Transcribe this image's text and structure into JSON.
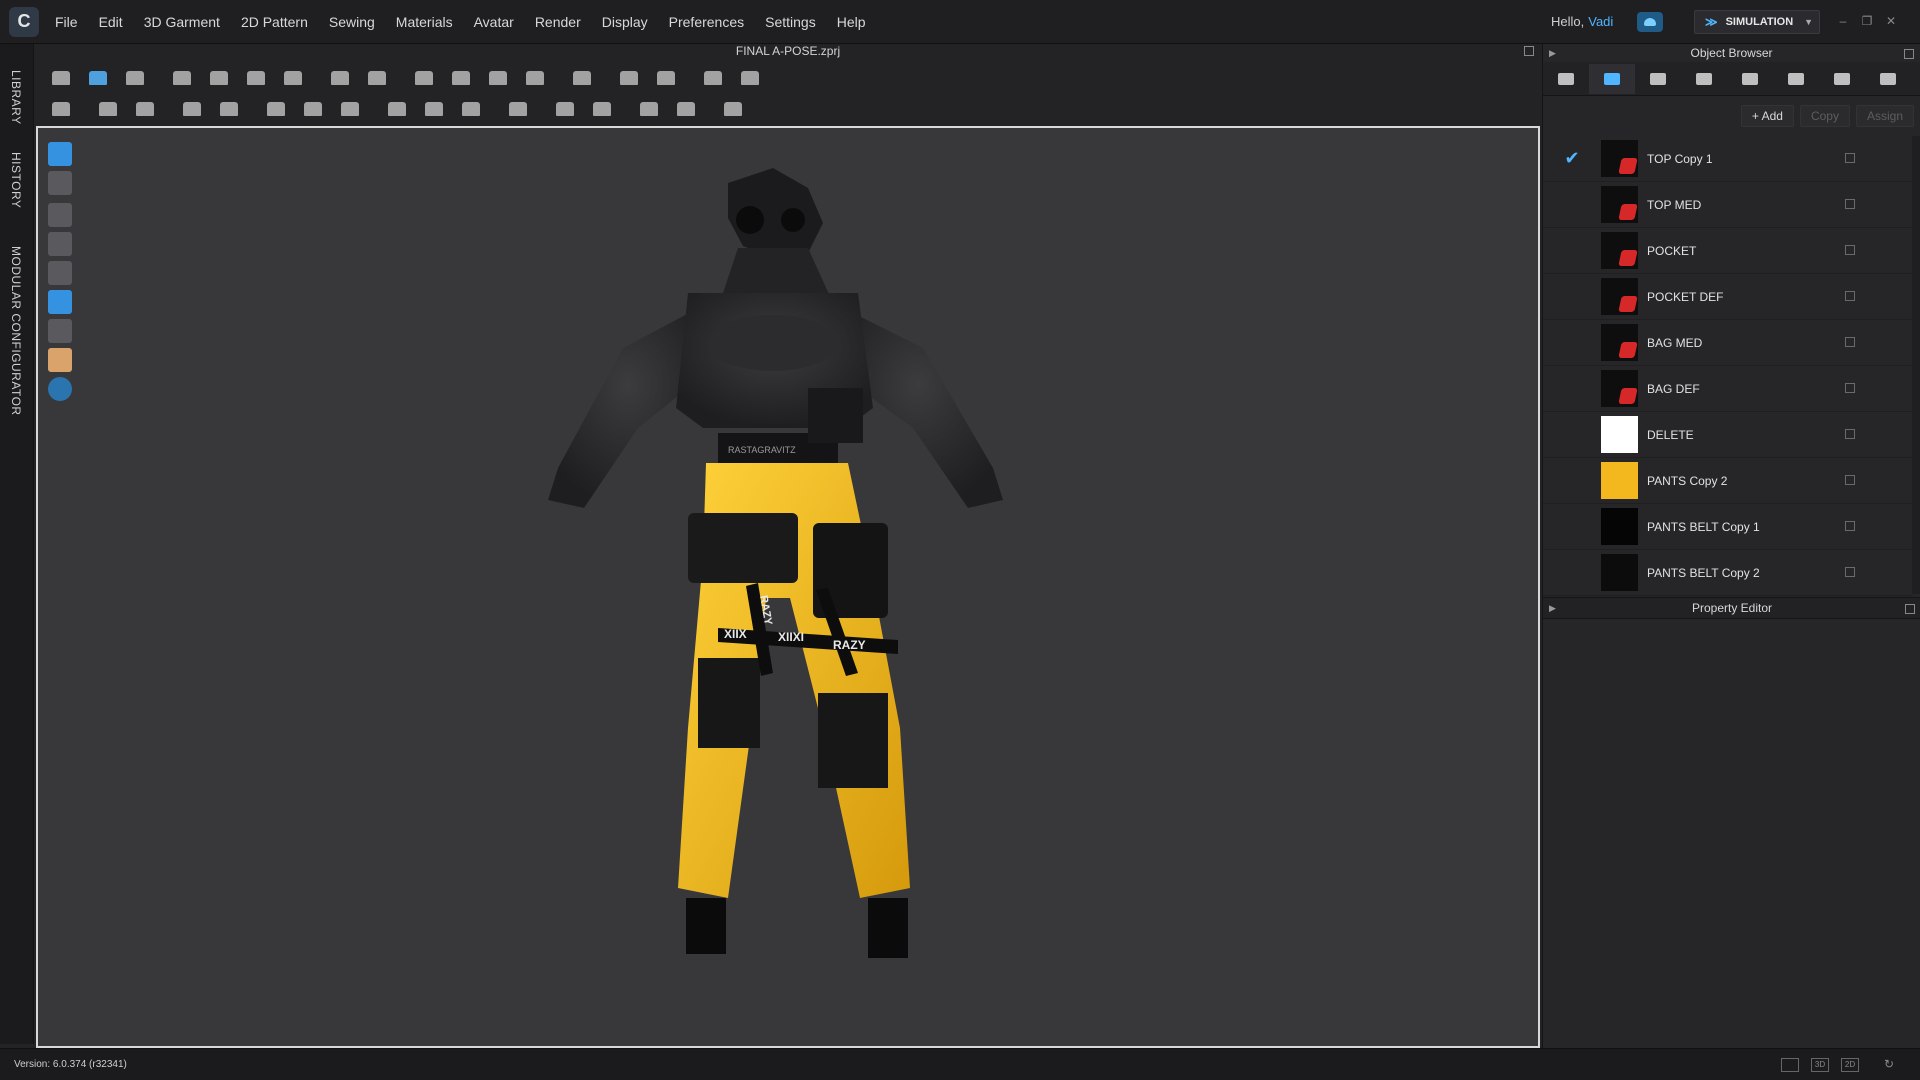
{
  "menu": [
    "File",
    "Edit",
    "3D Garment",
    "2D Pattern",
    "Sewing",
    "Materials",
    "Avatar",
    "Render",
    "Display",
    "Preferences",
    "Settings",
    "Help"
  ],
  "greeting": {
    "hello": "Hello,",
    "user": "Vadi"
  },
  "mode": {
    "label": "SIMULATION"
  },
  "vertical_tabs": [
    "LIBRARY",
    "HISTORY",
    "MODULAR CONFIGURATOR"
  ],
  "window_title": "FINAL A-POSE.zprj",
  "object_browser": {
    "title": "Object Browser",
    "actions": {
      "add": "+ Add",
      "copy": "Copy",
      "assign": "Assign"
    },
    "items": [
      {
        "name": "TOP Copy 1",
        "swatch": "fabric",
        "color": "#0e0e0e",
        "selected": true
      },
      {
        "name": "TOP MED",
        "swatch": "fabric",
        "color": "#0e0e0e",
        "selected": false
      },
      {
        "name": "POCKET",
        "swatch": "fabric",
        "color": "#0e0e0e",
        "selected": false
      },
      {
        "name": "POCKET DEF",
        "swatch": "fabric",
        "color": "#0e0e0e",
        "selected": false
      },
      {
        "name": "BAG MED",
        "swatch": "fabric",
        "color": "#0e0e0e",
        "selected": false
      },
      {
        "name": "BAG DEF",
        "swatch": "fabric",
        "color": "#0e0e0e",
        "selected": false
      },
      {
        "name": "DELETE",
        "swatch": "solid",
        "color": "#ffffff",
        "selected": false
      },
      {
        "name": "PANTS Copy 2",
        "swatch": "solid",
        "color": "#f2b81e",
        "selected": false
      },
      {
        "name": "PANTS BELT Copy 1",
        "swatch": "solid",
        "color": "#050505",
        "selected": false
      },
      {
        "name": "PANTS BELT Copy 2",
        "swatch": "solid",
        "color": "#0c0c0c",
        "selected": false
      }
    ]
  },
  "property_editor": {
    "title": "Property Editor"
  },
  "status": {
    "version": "Version: 6.0.374 (r32341)"
  },
  "garment_labels": {
    "chest": "RAZY",
    "strap_left": "XIIX",
    "strap_mid": "XIIXI",
    "strap_right": "RAZY",
    "belt": "RASTAGRAVITZ"
  },
  "colors": {
    "accent": "#4fb6ff",
    "pants": "#f2b81e",
    "top": "#2a2a2c",
    "viewport_bg": "#38383a"
  }
}
